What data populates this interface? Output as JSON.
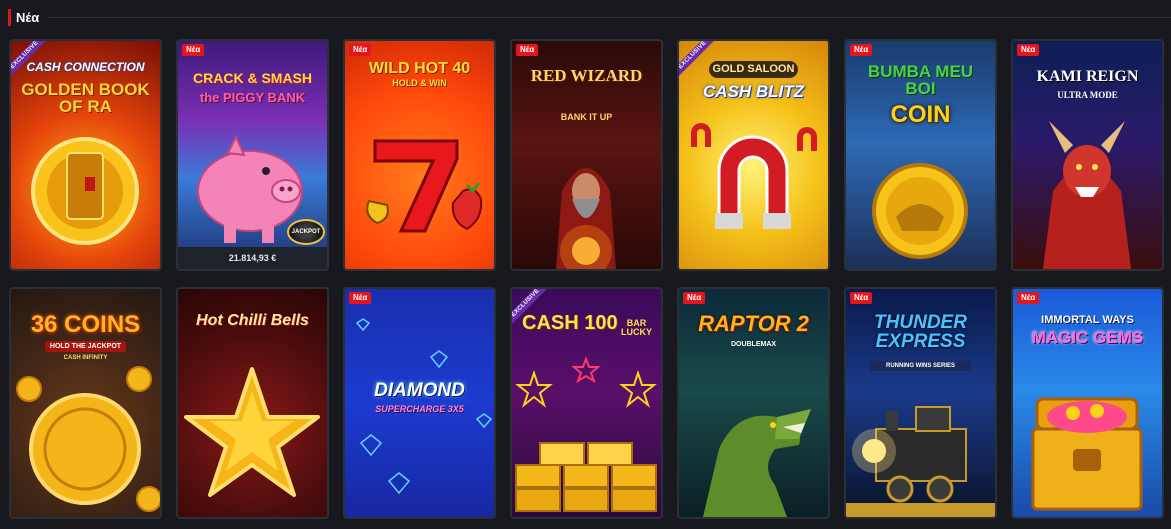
{
  "section": {
    "title": "Νέα"
  },
  "new_badge": "Νέα",
  "exclusive_ribbon": "EXCLUSIVE",
  "games": [
    {
      "title": "CASH CONNECTION",
      "subtitle": "GOLDEN BOOK OF RA",
      "exclusive": true,
      "new": false
    },
    {
      "title": "CRACK & SMASH",
      "subtitle": "the PIGGY BANK",
      "new": true,
      "jackpot_amount": "21.814,93 €",
      "jackpot_logo": "JACKPOT"
    },
    {
      "title": "WILD HOT 40",
      "subtitle": "HOLD & WIN",
      "new": true
    },
    {
      "title": "RED WIZARD",
      "subtitle": "BANK IT UP",
      "new": true
    },
    {
      "title": "GOLD SALOON",
      "subtitle": "CASH BLITZ",
      "exclusive": true,
      "new": false
    },
    {
      "title": "BUMBA MEU BOI",
      "subtitle": "COIN",
      "new": true
    },
    {
      "title": "KAMI REIGN",
      "subtitle": "ULTRA MODE",
      "new": true
    },
    {
      "title": "36 COINS",
      "subtitle": "HOLD THE JACKPOT",
      "tagline": "CASH INFINITY",
      "new": false
    },
    {
      "title": "Hot Chilli Bells",
      "new": false
    },
    {
      "title": "DIAMOND",
      "subtitle": "SUPERCHARGE 3X5",
      "new": true
    },
    {
      "title": "CASH 100",
      "subtitle": "BAR LUCKY",
      "exclusive": true,
      "new": false
    },
    {
      "title": "RAPTOR 2",
      "subtitle": "DOUBLEMAX",
      "new": true
    },
    {
      "title": "THUNDER EXPRESS",
      "subtitle": "RUNNING WINS SERIES",
      "new": true
    },
    {
      "title": "IMMORTAL WAYS",
      "subtitle": "MAGIC GEMS",
      "new": true
    }
  ]
}
